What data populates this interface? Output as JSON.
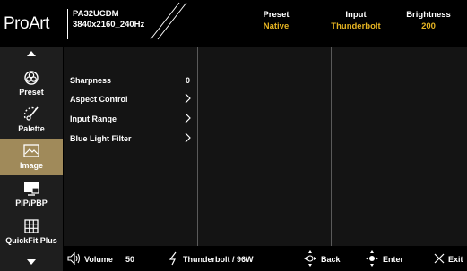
{
  "header": {
    "logo": "ProArt",
    "model_line1": "PA32UCDM",
    "model_line2": "3840x2160_240Hz",
    "columns": [
      {
        "label": "Preset",
        "value": "Native"
      },
      {
        "label": "Input",
        "value": "Thunderbolt"
      },
      {
        "label": "Brightness",
        "value": "200"
      }
    ],
    "accent_color": "#e6b422"
  },
  "sidebar": {
    "items": [
      {
        "label": "Preset",
        "icon": "preset-icon"
      },
      {
        "label": "Palette",
        "icon": "palette-icon"
      },
      {
        "label": "Image",
        "icon": "image-icon",
        "active": true
      },
      {
        "label": "PIP/PBP",
        "icon": "pip-pbp-icon"
      },
      {
        "label": "QuickFit Plus",
        "icon": "quickfit-grid-icon"
      }
    ],
    "active_color": "#a08a5a"
  },
  "menu": {
    "items": [
      {
        "label": "Sharpness",
        "value": "0"
      },
      {
        "label": "Aspect Control",
        "has_submenu": true
      },
      {
        "label": "Input Range",
        "has_submenu": true
      },
      {
        "label": "Blue Light Filter",
        "has_submenu": true
      }
    ]
  },
  "footer": {
    "volume_label": "Volume",
    "volume_value": "50",
    "power_label": "Thunderbolt / 96W",
    "back_label": "Back",
    "enter_label": "Enter",
    "exit_label": "Exit"
  }
}
